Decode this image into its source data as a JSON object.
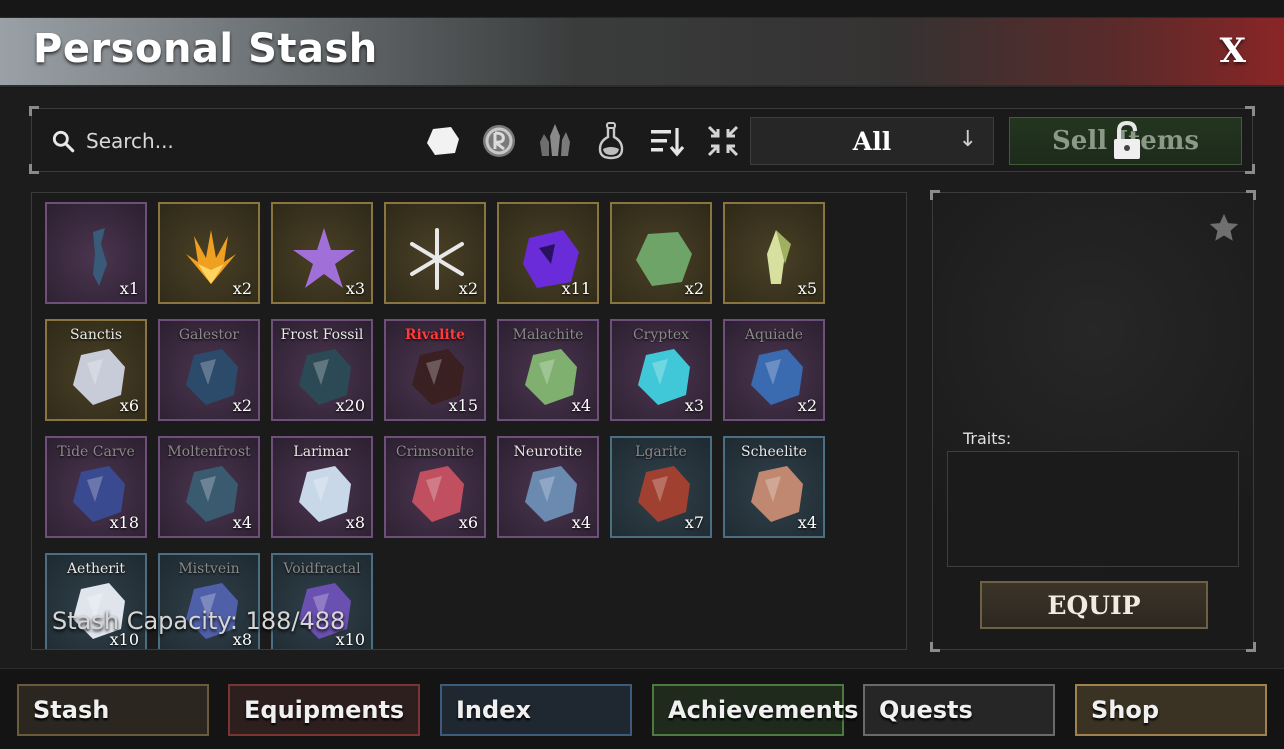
{
  "window": {
    "title": "Personal Stash",
    "close_label": "X"
  },
  "toolbar": {
    "search_placeholder": "Search...",
    "filter_icons": [
      "ore-filter-icon",
      "rune-filter-icon",
      "crystal-filter-icon",
      "potion-filter-icon",
      "sort-icon",
      "collapse-icon"
    ],
    "category_dropdown": {
      "selected": "All",
      "arrow": "↓"
    },
    "sell_label": "Sell Items",
    "sell_locked": true
  },
  "inventory": {
    "rows": [
      [
        {
          "name": "",
          "qty": "x1",
          "rarity": "purple",
          "color": "#3a5a7a"
        },
        {
          "name": "",
          "qty": "x2",
          "rarity": "gold",
          "color": "#f0a020"
        },
        {
          "name": "",
          "qty": "x3",
          "rarity": "gold",
          "color": "#a070d8"
        },
        {
          "name": "",
          "qty": "x2",
          "rarity": "gold",
          "color": "#e8e8e8"
        },
        {
          "name": "",
          "qty": "x11",
          "rarity": "gold",
          "color": "#6a2cd8"
        },
        {
          "name": "",
          "qty": "x2",
          "rarity": "gold",
          "color": "#6fa468"
        },
        {
          "name": "",
          "qty": "x5",
          "rarity": "gold",
          "color": "#d8e0a0"
        }
      ],
      [
        {
          "name": "Sanctis",
          "qty": "x6",
          "rarity": "gold",
          "color": "#c8ccd8",
          "label_style": "normal"
        },
        {
          "name": "Galestor",
          "qty": "x2",
          "rarity": "purple",
          "color": "#2c4a6a",
          "label_style": "dim"
        },
        {
          "name": "Frost Fossil",
          "qty": "x20",
          "rarity": "purple",
          "color": "#2c4a55",
          "label_style": "normal"
        },
        {
          "name": "Rivalite",
          "qty": "x15",
          "rarity": "purple",
          "color": "#3a2020",
          "label_style": "red"
        },
        {
          "name": "Malachite",
          "qty": "x4",
          "rarity": "purple",
          "color": "#7fb070",
          "label_style": "dim"
        },
        {
          "name": "Cryptex",
          "qty": "x3",
          "rarity": "purple",
          "color": "#40c8d8",
          "label_style": "dim"
        },
        {
          "name": "Aquiade",
          "qty": "x2",
          "rarity": "purple",
          "color": "#3a6ab0",
          "label_style": "dim"
        }
      ],
      [
        {
          "name": "Tide Carve",
          "qty": "x18",
          "rarity": "purple",
          "color": "#3a4a90",
          "label_style": "dim"
        },
        {
          "name": "Moltenfrost",
          "qty": "x4",
          "rarity": "purple",
          "color": "#3a5a70",
          "label_style": "dim"
        },
        {
          "name": "Larimar",
          "qty": "x8",
          "rarity": "purple",
          "color": "#c8d8e8",
          "label_style": "normal"
        },
        {
          "name": "Crimsonite",
          "qty": "x6",
          "rarity": "purple",
          "color": "#c05060",
          "label_style": "dim"
        },
        {
          "name": "Neurotite",
          "qty": "x4",
          "rarity": "purple",
          "color": "#6a8ab0",
          "label_style": "normal"
        },
        {
          "name": "Lgarite",
          "qty": "x7",
          "rarity": "blue",
          "color": "#a04030",
          "label_style": "dim"
        },
        {
          "name": "Scheelite",
          "qty": "x4",
          "rarity": "blue",
          "color": "#c08870",
          "label_style": "normal"
        }
      ],
      [
        {
          "name": "Aetherit",
          "qty": "x10",
          "rarity": "blue",
          "color": "#e0e4ec",
          "label_style": "normal"
        },
        {
          "name": "Mistvein",
          "qty": "x8",
          "rarity": "blue",
          "color": "#5060a8",
          "label_style": "dim"
        },
        {
          "name": "Voidfractal",
          "qty": "x10",
          "rarity": "blue",
          "color": "#6a50b0",
          "label_style": "dim"
        }
      ]
    ],
    "capacity_text": "Stash Capacity: 188/488"
  },
  "detail": {
    "favorite_icon": "star-icon",
    "traits_label": "Traits:",
    "traits_text": "",
    "equip_label": "EQUIP"
  },
  "nav": {
    "tabs": [
      {
        "label": "Stash"
      },
      {
        "label": "Equipments"
      },
      {
        "label": "Index"
      },
      {
        "label": "Achievements"
      },
      {
        "label": "Quests"
      },
      {
        "label": "Shop"
      }
    ]
  }
}
